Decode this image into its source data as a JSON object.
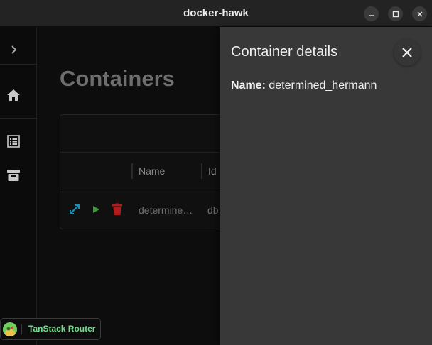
{
  "window": {
    "title": "docker-hawk",
    "controls": [
      "minimize-icon",
      "maximize-icon",
      "close-icon"
    ]
  },
  "sidebar": {
    "items": [
      {
        "icon": "chevron-right-icon"
      },
      {
        "icon": "home-icon"
      },
      {
        "icon": "list-icon"
      },
      {
        "icon": "archive-icon"
      }
    ]
  },
  "main": {
    "title": "Containers",
    "table": {
      "columns": [
        "Name",
        "Id"
      ],
      "rows": [
        {
          "actions": [
            "expand-icon",
            "play-icon",
            "delete-icon"
          ],
          "name": "determine…",
          "id": "db"
        }
      ]
    }
  },
  "router_badge": {
    "label": "TanStack Router"
  },
  "details": {
    "title": "Container details",
    "name_label": "Name:",
    "name_value": "determined_hermann"
  },
  "colors": {
    "expand_icon": "#1e8fb5",
    "play_icon": "#3a9a3a",
    "delete_icon": "#b01c1c",
    "router_label": "#6fe08a",
    "panel_bg": "#383838"
  }
}
